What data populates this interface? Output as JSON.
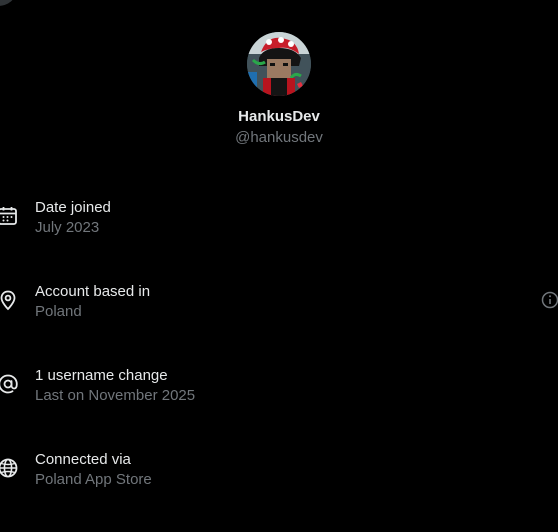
{
  "profile": {
    "display_name": "HankusDev",
    "username": "@hankusdev"
  },
  "rows": [
    {
      "icon": "calendar-icon",
      "title": "Date joined",
      "value": "July 2023"
    },
    {
      "icon": "location-pin-icon",
      "title": "Account based in",
      "value": "Poland"
    },
    {
      "icon": "at-sign-icon",
      "title": "1 username change",
      "value": "Last on November 2025"
    },
    {
      "icon": "globe-icon",
      "title": "Connected via",
      "value": "Poland App Store"
    }
  ],
  "colors": {
    "background": "#000000",
    "primary_text": "#e7e9ea",
    "secondary_text": "#71767b"
  }
}
